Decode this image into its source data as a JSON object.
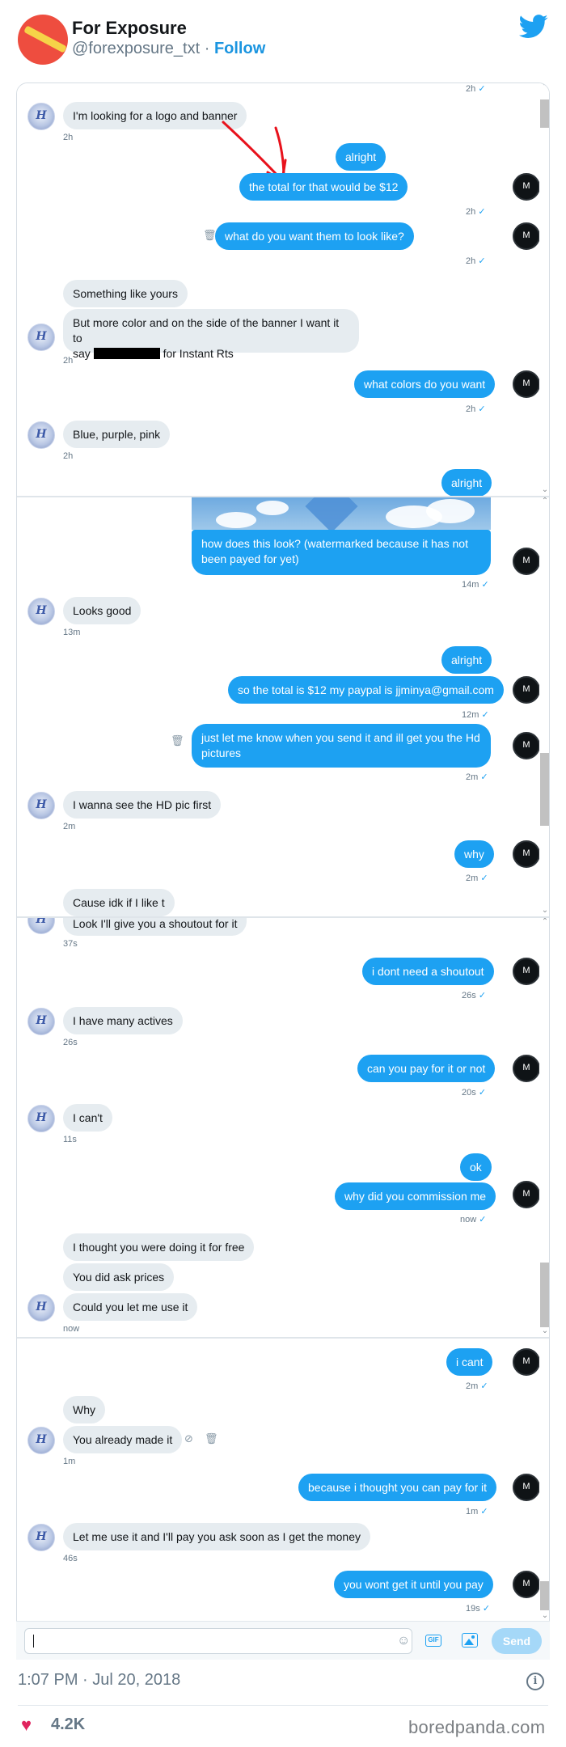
{
  "header": {
    "display_name": "For Exposure",
    "handle": "@forexposure_txt",
    "separator": " · ",
    "follow_label": "Follow"
  },
  "contact_avatar_letter": "H",
  "own_avatar_letter": "M",
  "panel1": {
    "top_time": "2h",
    "messages": [
      {
        "from": "them",
        "text": "I'm looking for a logo and banner",
        "time": "2h"
      },
      {
        "from": "me",
        "text": "alright"
      },
      {
        "from": "me",
        "text": "the total for that would be $12",
        "time": "2h"
      },
      {
        "from": "me",
        "text": "what do you want them to look like?",
        "time": "2h"
      },
      {
        "from": "them",
        "text": "Something like yours"
      },
      {
        "from": "them",
        "text_line1": "But more color and on the side of the banner I want it to",
        "text_line2_pre": "say",
        "text_line2_post": "for Instant Rts",
        "time": "2h"
      },
      {
        "from": "me",
        "text": "what colors do you want",
        "time": "2h"
      },
      {
        "from": "them",
        "text": "Blue, purple, pink",
        "time": "2h"
      },
      {
        "from": "me",
        "text": "alright"
      }
    ]
  },
  "panel2": {
    "messages": [
      {
        "from": "me",
        "text": "how does this look? (watermarked because it has not been payed for yet)",
        "time": "14m"
      },
      {
        "from": "them",
        "text": "Looks good",
        "time": "13m"
      },
      {
        "from": "me",
        "text": "alright"
      },
      {
        "from": "me",
        "text": "so the total is $12 my paypal is jjminya@gmail.com",
        "time": "12m"
      },
      {
        "from": "me",
        "text": "just let me know when you send it and ill get you the Hd pictures",
        "time": "2m"
      },
      {
        "from": "them",
        "text": "I wanna see the HD pic first",
        "time": "2m"
      },
      {
        "from": "me",
        "text": "why",
        "time": "2m"
      },
      {
        "from": "them",
        "text": "Cause idk if I like t"
      }
    ]
  },
  "panel3": {
    "messages": [
      {
        "from": "them",
        "text": "Look I'll give you a shoutout for it",
        "time": "37s"
      },
      {
        "from": "me",
        "text": "i dont need a shoutout",
        "time": "26s"
      },
      {
        "from": "them",
        "text": "I have many actives",
        "time": "26s"
      },
      {
        "from": "me",
        "text": "can you pay for it or not",
        "time": "20s"
      },
      {
        "from": "them",
        "text": "I can't",
        "time": "11s"
      },
      {
        "from": "me",
        "text": "ok"
      },
      {
        "from": "me",
        "text": "why did you commission me",
        "time": "now"
      },
      {
        "from": "them",
        "text": "I thought you were doing it for free"
      },
      {
        "from": "them",
        "text": "You did ask prices"
      },
      {
        "from": "them",
        "text": "Could you let me use it",
        "time": "now"
      }
    ]
  },
  "panel4": {
    "messages": [
      {
        "from": "me",
        "text": "i cant",
        "time": "2m"
      },
      {
        "from": "them",
        "text": "Why"
      },
      {
        "from": "them",
        "text": "You already made it",
        "time": "1m"
      },
      {
        "from": "me",
        "text": "because i thought you can pay for it",
        "time": "1m"
      },
      {
        "from": "them",
        "text": "Let me use it and I'll pay you ask soon as I get the money",
        "time": "46s"
      },
      {
        "from": "me",
        "text": "you wont get it until you pay",
        "time": "19s"
      }
    ]
  },
  "composer": {
    "send_label": "Send",
    "gif_label": "GIF"
  },
  "footer": {
    "timestamp": "1:07 PM · Jul 20, 2018",
    "likes": "4.2K",
    "watermark": "boredpanda.com"
  },
  "colors": {
    "outgoing_bubble": "#1da1f2",
    "incoming_bubble": "#e6ecf0",
    "annotation_arrow": "#e8121c",
    "like_heart": "#e0245e"
  },
  "icons": [
    "twitter-bird-icon",
    "trash-icon",
    "block-icon",
    "emoji-icon",
    "gif-icon",
    "image-icon",
    "info-icon",
    "heart-icon",
    "checkmark-icon"
  ]
}
